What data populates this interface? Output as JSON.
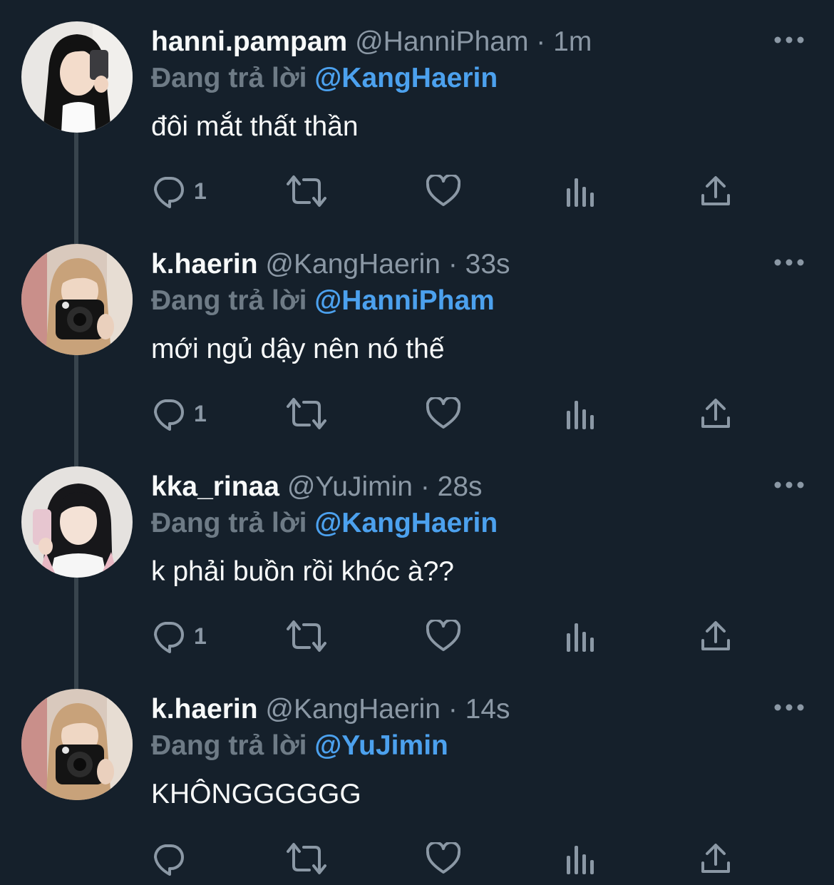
{
  "tweets": [
    {
      "display_name": "hanni.pampam",
      "handle": "@HanniPham",
      "separator": "·",
      "time": "1m",
      "reply_prefix": "Đang trả lời",
      "reply_to": "@KangHaerin",
      "text": "đôi mắt thất thần",
      "reply_count": "1",
      "avatar": "hanni-avatar"
    },
    {
      "display_name": "k.haerin",
      "handle": "@KangHaerin",
      "separator": "·",
      "time": "33s",
      "reply_prefix": "Đang trả lời",
      "reply_to": "@HanniPham",
      "text": "mới ngủ dậy nên nó thế",
      "reply_count": "1",
      "avatar": "haerin-avatar"
    },
    {
      "display_name": "kka_rinaa",
      "handle": "@YuJimin",
      "separator": "·",
      "time": "28s",
      "reply_prefix": "Đang trả lời",
      "reply_to": "@KangHaerin",
      "text": "k phải buồn rồi khóc à??",
      "reply_count": "1",
      "avatar": "jimin-avatar"
    },
    {
      "display_name": "k.haerin",
      "handle": "@KangHaerin",
      "separator": "·",
      "time": "14s",
      "reply_prefix": "Đang trả lời",
      "reply_to": "@YuJimin",
      "text": "KHÔNGGGGGG",
      "reply_count": "",
      "avatar": "haerin-avatar"
    }
  ],
  "icons": {
    "reply": "reply-icon",
    "retweet": "retweet-icon",
    "like": "heart-icon",
    "views": "views-icon",
    "share": "share-icon",
    "more": "more-icon"
  },
  "colors": {
    "background": "#15202b",
    "primary_text": "#f7f9f9",
    "secondary_text": "#8b98a5",
    "mention": "#4ca1ee",
    "thread_line": "#38444d"
  }
}
